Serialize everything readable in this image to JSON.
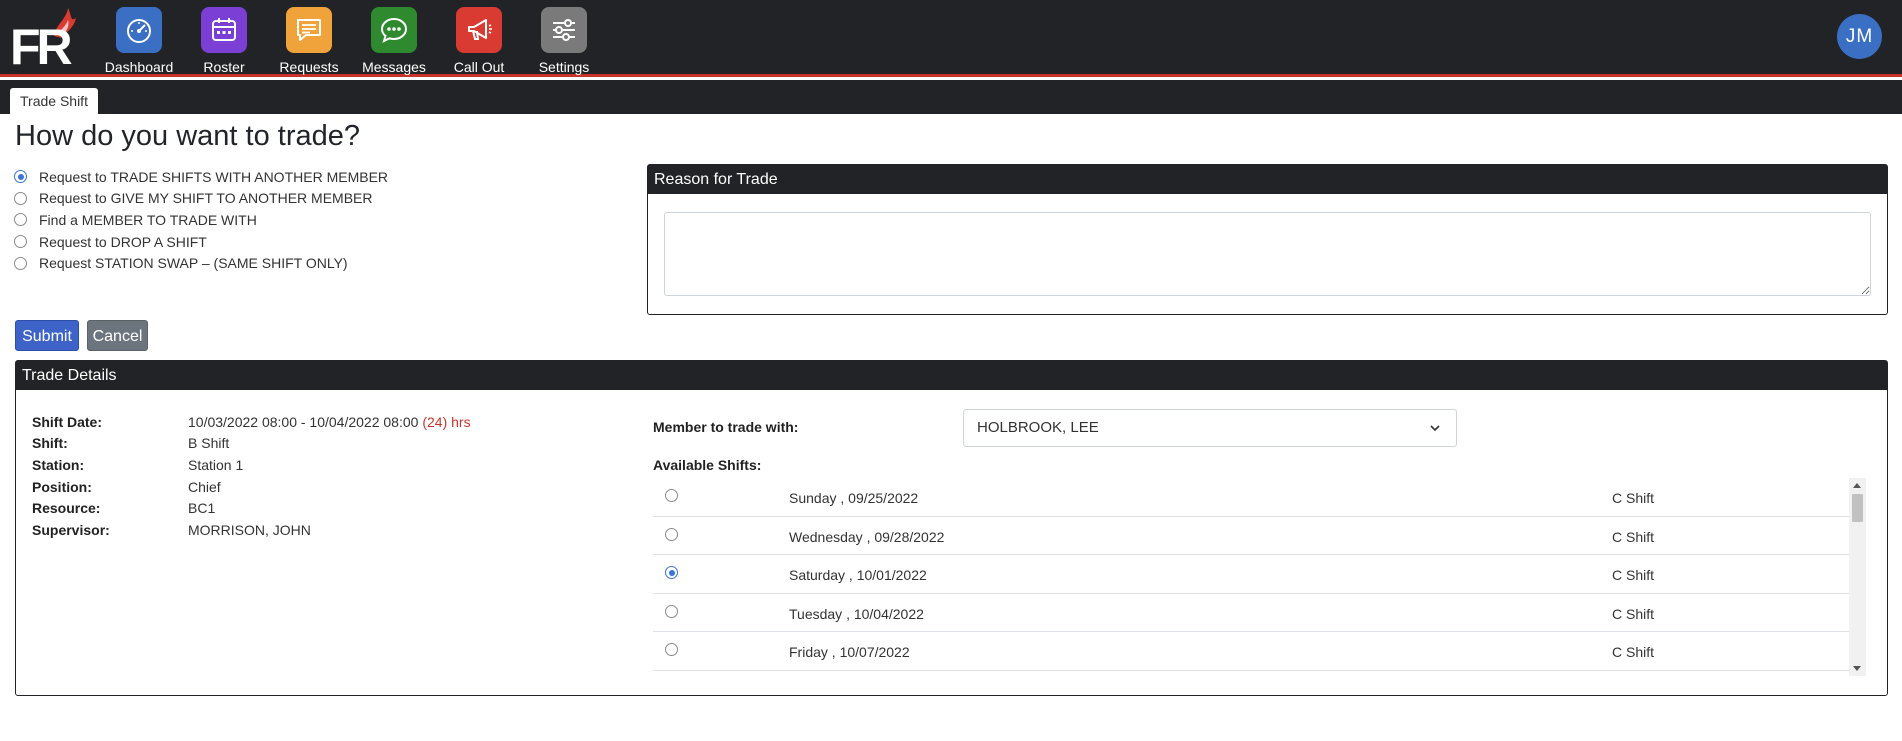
{
  "nav": {
    "logo_text": "FR",
    "items": [
      {
        "label": "Dashboard",
        "icon": "gauge-icon",
        "color": "#3a6fc4"
      },
      {
        "label": "Roster",
        "icon": "calendar-icon",
        "color": "#7b3fd6"
      },
      {
        "label": "Requests",
        "icon": "message-lines-icon",
        "color": "#f0a33a"
      },
      {
        "label": "Messages",
        "icon": "chat-bubble-icon",
        "color": "#2f8a2f"
      },
      {
        "label": "Call Out",
        "icon": "megaphone-icon",
        "color": "#d93a32"
      },
      {
        "label": "Settings",
        "icon": "sliders-icon",
        "color": "#7a7a7a"
      }
    ],
    "user_initials": "JM"
  },
  "tab": {
    "label": "Trade Shift"
  },
  "page": {
    "title": "How do you want to trade?"
  },
  "trade_options": [
    {
      "label": "Request to TRADE SHIFTS WITH ANOTHER MEMBER",
      "checked": true
    },
    {
      "label": "Request to GIVE MY SHIFT TO ANOTHER MEMBER",
      "checked": false
    },
    {
      "label": "Find a MEMBER TO TRADE WITH",
      "checked": false
    },
    {
      "label": "Request to DROP A SHIFT",
      "checked": false
    },
    {
      "label": "Request STATION SWAP – (SAME SHIFT ONLY)",
      "checked": false
    }
  ],
  "reason": {
    "header": "Reason for Trade",
    "value": ""
  },
  "actions": {
    "submit": "Submit",
    "cancel": "Cancel"
  },
  "details": {
    "header": "Trade Details",
    "fields": [
      {
        "label": "Shift Date:",
        "value": "10/03/2022 08:00 - 10/04/2022 08:00",
        "extra": "(24) hrs"
      },
      {
        "label": "Shift:",
        "value": "B Shift"
      },
      {
        "label": "Station:",
        "value": "Station 1"
      },
      {
        "label": "Position:",
        "value": "Chief"
      },
      {
        "label": "Resource:",
        "value": "BC1"
      },
      {
        "label": "Supervisor:",
        "value": "MORRISON, JOHN"
      }
    ],
    "member_label": "Member to trade with:",
    "member_value": "HOLBROOK, LEE",
    "available_label": "Available Shifts:",
    "shifts": [
      {
        "day": "Sunday , 09/25/2022",
        "shift": "C Shift",
        "checked": false
      },
      {
        "day": "Wednesday , 09/28/2022",
        "shift": "C Shift",
        "checked": false
      },
      {
        "day": "Saturday , 10/01/2022",
        "shift": "C Shift",
        "checked": true
      },
      {
        "day": "Tuesday , 10/04/2022",
        "shift": "C Shift",
        "checked": false
      },
      {
        "day": "Friday , 10/07/2022",
        "shift": "C Shift",
        "checked": false
      }
    ]
  },
  "colors": {
    "header_bg": "#212326",
    "accent_red": "#c8342b",
    "primary": "#3d63c9",
    "secondary": "#6c757d"
  }
}
